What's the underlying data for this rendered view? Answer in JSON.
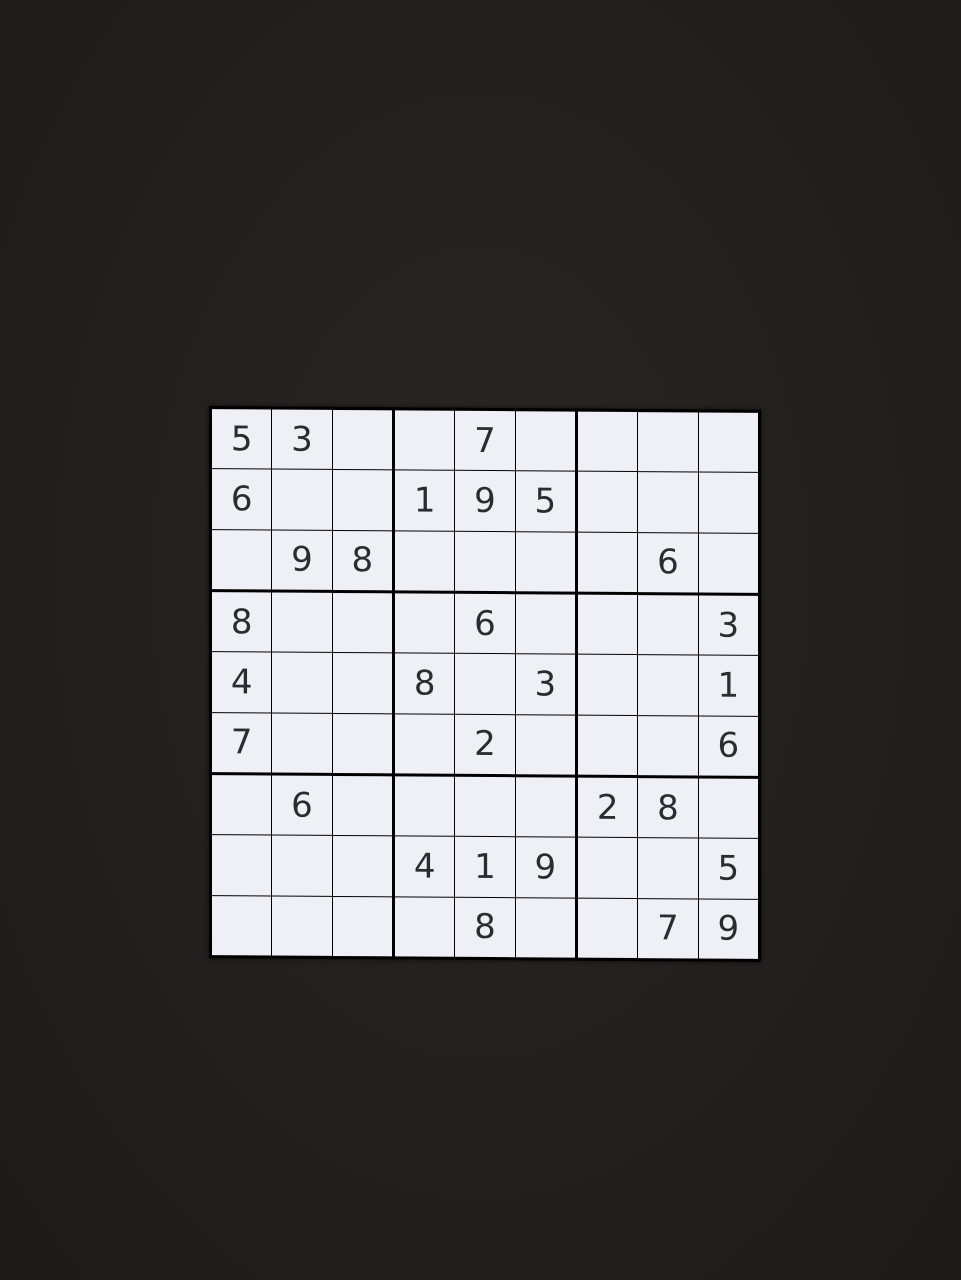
{
  "grid": [
    [
      "5",
      "3",
      "",
      "",
      "7",
      "",
      "",
      "",
      ""
    ],
    [
      "6",
      "",
      "",
      "1",
      "9",
      "5",
      "",
      "",
      ""
    ],
    [
      "",
      "9",
      "8",
      "",
      "",
      "",
      "",
      "6",
      ""
    ],
    [
      "8",
      "",
      "",
      "",
      "6",
      "",
      "",
      "",
      "3"
    ],
    [
      "4",
      "",
      "",
      "8",
      "",
      "3",
      "",
      "",
      "1"
    ],
    [
      "7",
      "",
      "",
      "",
      "2",
      "",
      "",
      "",
      "6"
    ],
    [
      "",
      "6",
      "",
      "",
      "",
      "",
      "2",
      "8",
      ""
    ],
    [
      "",
      "",
      "",
      "4",
      "1",
      "9",
      "",
      "",
      "5"
    ],
    [
      "",
      "",
      "",
      "",
      "8",
      "",
      "",
      "7",
      "9"
    ]
  ],
  "colors": {
    "background": "#221f1d",
    "cell": "#eef0f6",
    "digit": "#2c2c30",
    "grid_line": "#000000"
  }
}
